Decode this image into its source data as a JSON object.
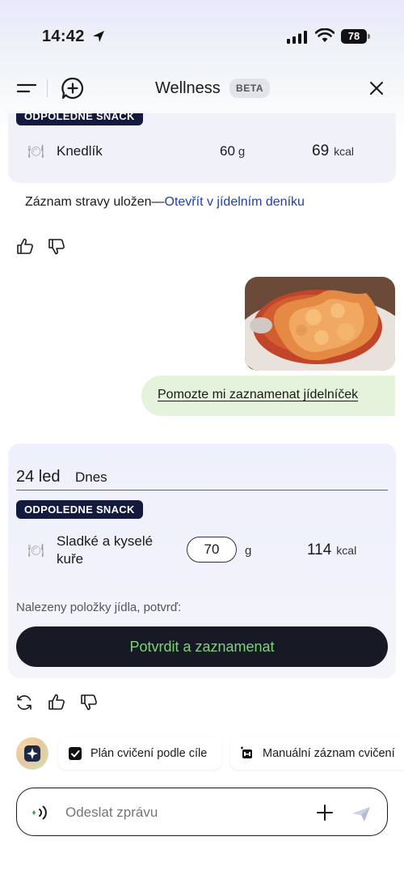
{
  "status_bar": {
    "time": "14:42",
    "battery": "78"
  },
  "header": {
    "title": "Wellness",
    "badge": "BETA"
  },
  "previous_entry": {
    "meal_tag": "ODPOLEDNE SNACK",
    "food": "Knedlík",
    "grams": "60",
    "grams_unit": "g",
    "kcal": "69",
    "kcal_unit": "kcal",
    "icon": "plate-icon"
  },
  "saved_message": {
    "text": "Záznam stravy uložen—",
    "link": "Otevřít v jídelním deníku"
  },
  "user_message": {
    "text": "Pomozte mi zaznamenat jídelníček",
    "image": "sweet-and-sour-chicken-photo"
  },
  "log_card": {
    "date": "24 led",
    "date_label": "Dnes",
    "meal_tag": "ODPOLEDNE SNACK",
    "food_line1": "Sladké a kyselé",
    "food_line2": "kuře",
    "quantity": "70",
    "grams_unit": "g",
    "kcal": "114",
    "kcal_unit": "kcal",
    "found_text": "Nalezeny položky jídla, potvrď:",
    "confirm_label": "Potvrdit a zaznamenat"
  },
  "suggestions": [
    {
      "label": "Plán cvičení podle cíle",
      "icon": "checkbox-icon"
    },
    {
      "label": "Manuální záznam cvičení",
      "icon": "dumbbell-icon"
    }
  ],
  "composer": {
    "placeholder": "Odeslat zprávu"
  },
  "colors": {
    "pill_bg": "#141a3e",
    "link": "#1f3fae",
    "user_bubble": "#e5f2dc",
    "confirm_bg": "#171a24",
    "confirm_text": "#7ed37a"
  }
}
